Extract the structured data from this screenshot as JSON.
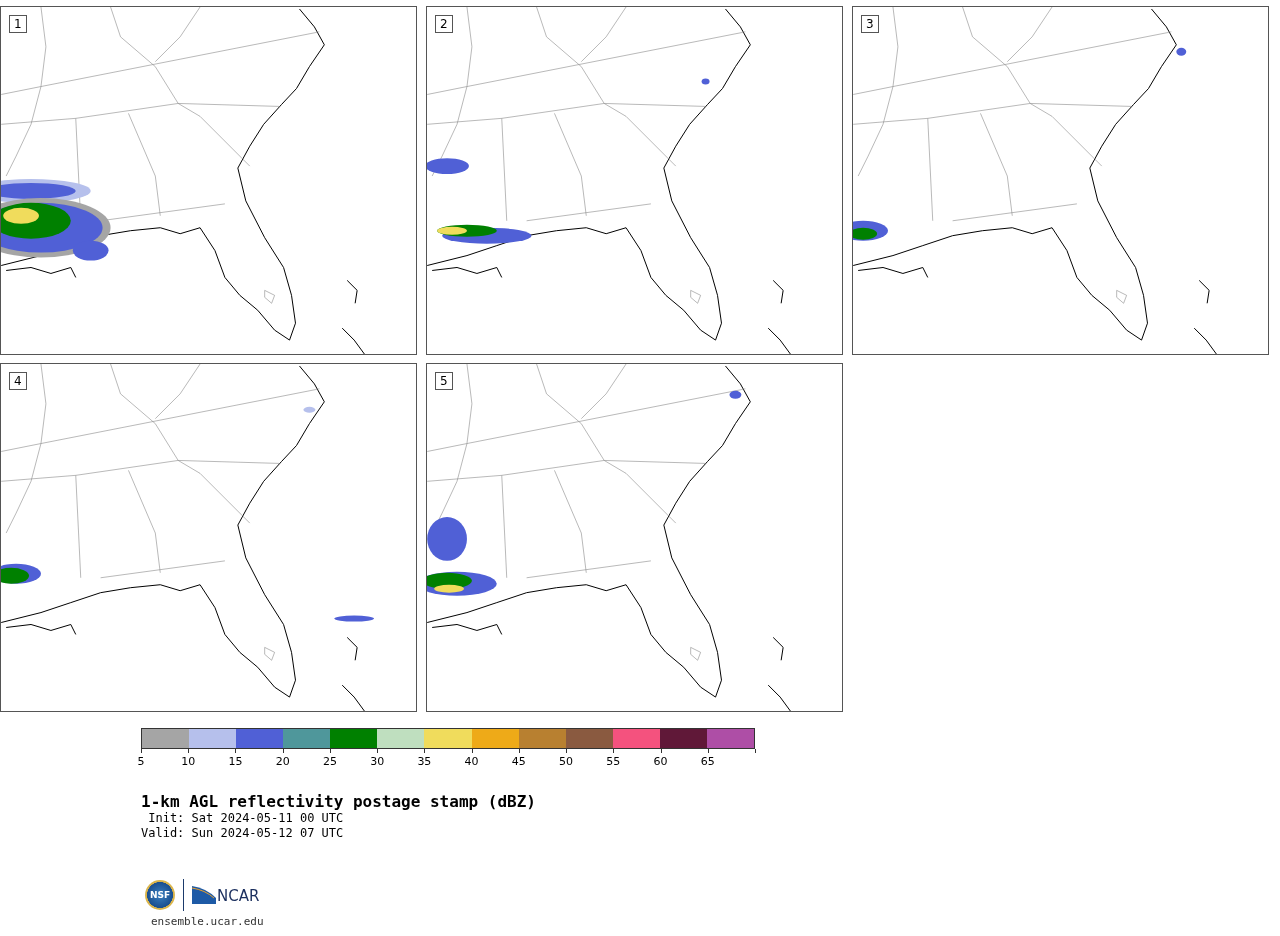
{
  "panels": [
    {
      "label": "1"
    },
    {
      "label": "2"
    },
    {
      "label": "3"
    },
    {
      "label": "4"
    },
    {
      "label": "5"
    }
  ],
  "colorbar": {
    "bins": [
      {
        "color": "#a5a5a5"
      },
      {
        "color": "#b6c0ec"
      },
      {
        "color": "#5060d6"
      },
      {
        "color": "#4f979b"
      },
      {
        "color": "#008000"
      },
      {
        "color": "#bfdfbf"
      },
      {
        "color": "#f0dc5c"
      },
      {
        "color": "#eeaa18"
      },
      {
        "color": "#b88030"
      },
      {
        "color": "#8a5a40"
      },
      {
        "color": "#f4527e"
      },
      {
        "color": "#601838"
      },
      {
        "color": "#ae4ea6"
      }
    ],
    "ticks": [
      "5",
      "10",
      "15",
      "20",
      "25",
      "30",
      "35",
      "40",
      "45",
      "50",
      "55",
      "60",
      "65"
    ]
  },
  "title": "1-km AGL reflectivity postage stamp (dBZ)",
  "init": " Init: Sat 2024-05-11 00 UTC",
  "valid": "Valid: Sun 2024-05-12 07 UTC",
  "logos": {
    "seal": "NSF",
    "wordmark": "NCAR"
  },
  "footer": "ensemble.ucar.edu"
}
